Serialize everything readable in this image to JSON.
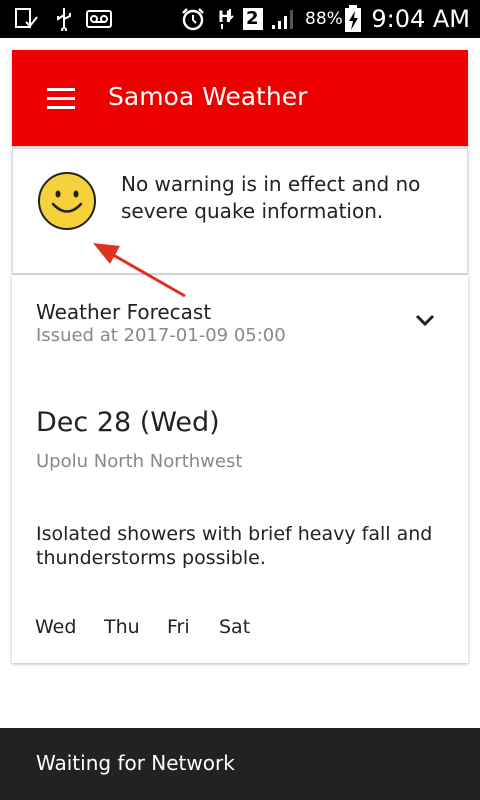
{
  "status_bar": {
    "battery_percent": "88%",
    "time": "9:04 AM",
    "sim_slot": "2",
    "icons": [
      "screenshot-notification-icon",
      "usb-icon",
      "voicemail-icon",
      "alarm-icon",
      "data-transfer-icon",
      "sim-2-icon",
      "signal-icon",
      "battery-charging-icon"
    ]
  },
  "app_bar": {
    "title": "Samoa Weather",
    "menu_icon": "hamburger-menu-icon"
  },
  "warning": {
    "icon": "smiley-face-icon",
    "text": "No warning is in effect and no severe quake information."
  },
  "forecast": {
    "title": "Weather Forecast",
    "issued": "Issued at 2017-01-09 05:00",
    "expand_icon": "chevron-down-icon",
    "date": "Dec 28 (Wed)",
    "region": "Upolu North Northwest",
    "description": "Isolated showers with brief heavy fall and thunderstorms possible.",
    "days": [
      "Wed",
      "Thu",
      "Fri",
      "Sat"
    ]
  },
  "snackbar": {
    "text": "Waiting for Network"
  },
  "colors": {
    "app_bar": "#ee0000",
    "snackbar": "#222222",
    "smiley": "#f5d23c",
    "annotation_arrow": "#e0301e"
  }
}
